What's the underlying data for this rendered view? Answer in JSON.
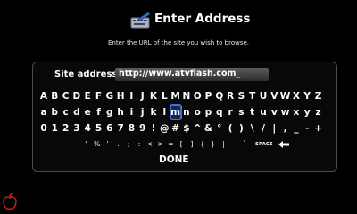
{
  "header": {
    "title": "Enter Address",
    "icon": "keyboard-icon"
  },
  "subtitle": "Enter the URL of the site you wish to browse.",
  "address": {
    "label": "Site address",
    "value": "http://www.atvflash.com_"
  },
  "keyboard": {
    "rows": [
      [
        "A",
        "B",
        "C",
        "D",
        "E",
        "F",
        "G",
        "H",
        "I",
        "J",
        "K",
        "L",
        "M",
        "N",
        "O",
        "P",
        "Q",
        "R",
        "S",
        "T",
        "U",
        "V",
        "W",
        "X",
        "Y",
        "Z"
      ],
      [
        "a",
        "b",
        "c",
        "d",
        "e",
        "f",
        "g",
        "h",
        "i",
        "j",
        "k",
        "l",
        "m",
        "n",
        "o",
        "p",
        "q",
        "r",
        "s",
        "t",
        "u",
        "v",
        "w",
        "x",
        "y",
        "z"
      ],
      [
        "0",
        "1",
        "2",
        "3",
        "4",
        "5",
        "6",
        "7",
        "8",
        "9",
        "!",
        "@",
        "#",
        "$",
        "^",
        "&",
        "°",
        "(",
        ")",
        "\\",
        "/",
        "|",
        ",",
        "_",
        "-",
        "+"
      ],
      [
        "\"",
        "%",
        "'",
        ".",
        ";",
        ":",
        "<",
        ">",
        "=",
        "[",
        "]",
        "{",
        "}",
        "|",
        "~",
        "`"
      ]
    ],
    "selected_key": "m",
    "space_label": "SPACE",
    "backspace_icon": "backspace-arrow-icon",
    "done_label": "DONE"
  },
  "corner_icon": "apple-logo-icon",
  "colors": {
    "background": "#000000",
    "selection": "#3d71d6",
    "field": "#4a4a4a"
  }
}
